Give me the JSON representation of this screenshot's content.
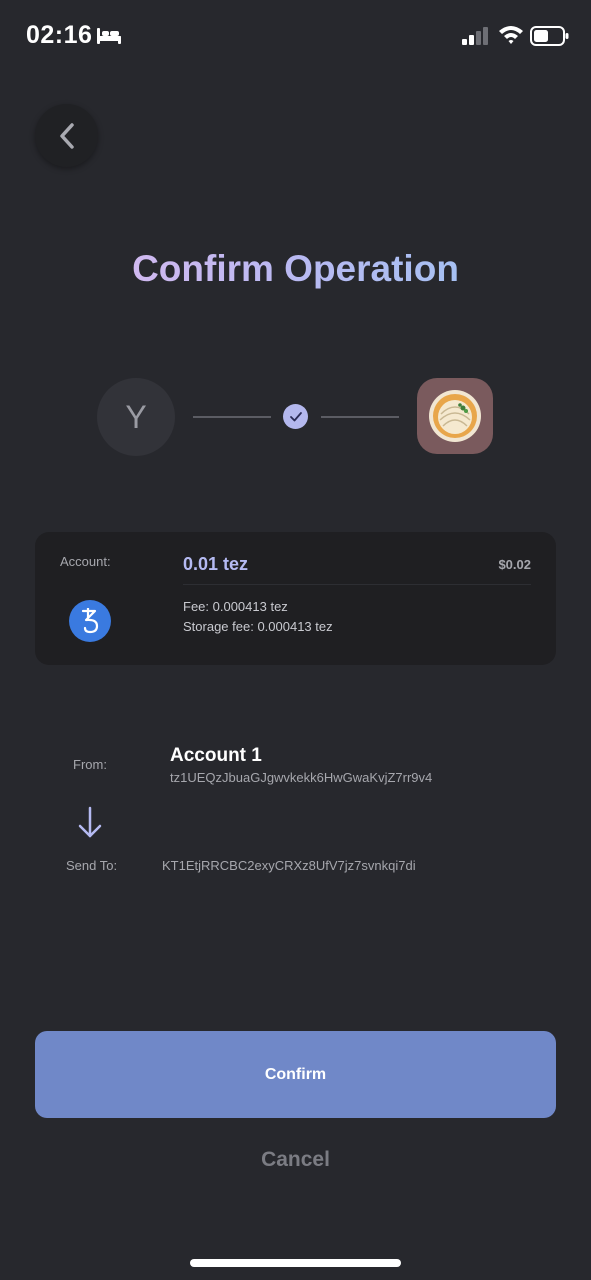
{
  "status_bar": {
    "time": "02:16",
    "icons": [
      "bed-icon",
      "signal-icon",
      "wifi-icon",
      "battery-icon"
    ]
  },
  "header": {
    "back_icon": "chevron-left-icon",
    "title": "Confirm Operation"
  },
  "connection": {
    "account_initial": "Y",
    "status_icon": "check-icon",
    "dapp_icon": "pie-dish-icon"
  },
  "amount_card": {
    "account_label": "Account:",
    "amount": "0.01 tez",
    "fiat": "$0.02",
    "token_icon": "tezos-icon",
    "fee": "Fee: 0.000413 tez",
    "storage_fee": "Storage fee: 0.000413 tez"
  },
  "transfer": {
    "from_label": "From:",
    "from_account": "Account 1",
    "from_address": "tz1UEQzJbuaGJgwvkekk6HwGwaKvjZ7rr9v4",
    "arrow_icon": "arrow-down-icon",
    "to_label": "Send To:",
    "to_address": "KT1EtjRRCBC2exyCRXz8UfV7jz7svnkqi7di"
  },
  "actions": {
    "confirm_label": "Confirm",
    "cancel_label": "Cancel"
  },
  "colors": {
    "background": "#27282d",
    "card": "#1f1f22",
    "accent": "#7088c8",
    "amount": "#b5baf2"
  }
}
